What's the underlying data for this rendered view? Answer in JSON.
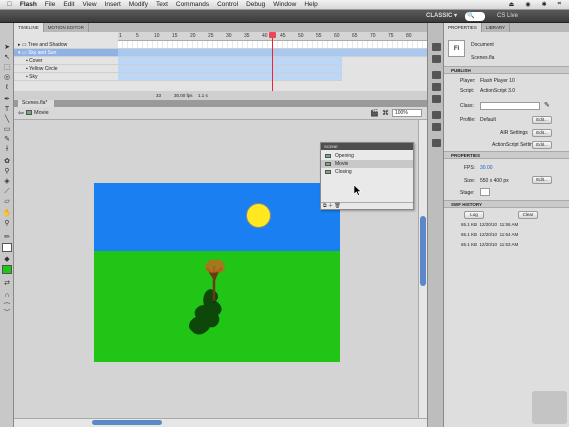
{
  "menubar": {
    "apple": "",
    "app": "Flash",
    "items": [
      "File",
      "Edit",
      "View",
      "Insert",
      "Modify",
      "Text",
      "Commands",
      "Control",
      "Debug",
      "Window",
      "Help"
    ],
    "right": [
      "⏏",
      "◉",
      "✱",
      "⌗"
    ]
  },
  "appbar": {
    "workspace": "CLASSIC ▾",
    "search_placeholder": "🔍",
    "cs_live": "CS Live"
  },
  "timeline": {
    "tabs": [
      "TIMELINE",
      "MOTION EDITOR"
    ],
    "ruler": [
      "1",
      "5",
      "10",
      "15",
      "20",
      "25",
      "30",
      "35",
      "40",
      "45",
      "50",
      "55",
      "60",
      "65",
      "70",
      "75",
      "80"
    ],
    "layers": [
      {
        "name": "Tree and Shadow",
        "folder": true
      },
      {
        "name": "Sky and Sun",
        "folder": true,
        "selected": true
      },
      {
        "name": "Cover",
        "folder": false
      },
      {
        "name": "Yellow Circle",
        "folder": false
      },
      {
        "name": "Sky",
        "folder": false
      }
    ],
    "status": {
      "frame": "33",
      "fps": "30.00 fps",
      "time": "1.1 s"
    }
  },
  "document": {
    "tab": "Scenes.fla*",
    "scene": "Movie",
    "zoom": "100%"
  },
  "scene_panel": {
    "title": "SCENE",
    "items": [
      "Opening",
      "Movie",
      "Closing"
    ],
    "selected_index": 1
  },
  "properties": {
    "tabs": [
      "PROPERTIES",
      "LIBRARY"
    ],
    "doc_icon": "Fl",
    "doc_type": "Document",
    "doc_name": "Scenes.fla",
    "publish": "PUBLISH",
    "player_label": "Player:",
    "player": "Flash Player 10",
    "script_label": "Script:",
    "script": "ActionScript 3.0",
    "class_label": "Class:",
    "profile_label": "Profile:",
    "profile": "Default",
    "edit": "Edit...",
    "air": "AIR Settings",
    "as_settings": "ActionScript Settings",
    "props_section": "PROPERTIES",
    "fps_label": "FPS:",
    "fps": "30.00",
    "size_label": "Size:",
    "size": "550 x 400 px",
    "stage_label": "Stage:",
    "history_section": "SWF HISTORY",
    "log": "Log",
    "clear": "Clear",
    "history": [
      {
        "size": "65.1 KB",
        "date": "12/20/10",
        "time": "11:55 AM"
      },
      {
        "size": "65.1 KB",
        "date": "12/20/10",
        "time": "11:54 AM"
      },
      {
        "size": "65.1 KB",
        "date": "12/20/10",
        "time": "11:53 AM"
      }
    ]
  },
  "colors": {
    "sky": "#1a7ff0",
    "grass": "#21c516",
    "sun": "#ffe81f",
    "playhead": "#e23344"
  }
}
